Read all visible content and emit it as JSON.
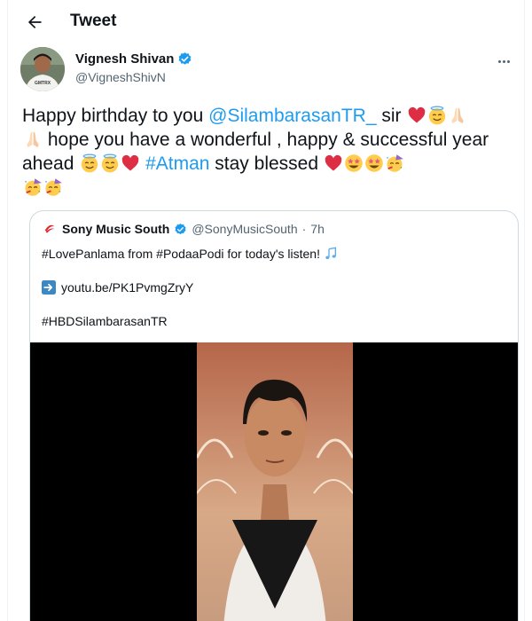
{
  "header": {
    "title": "Tweet",
    "back_icon": "arrow-left-icon"
  },
  "author": {
    "display_name": "Vignesh Shivan",
    "handle": "@VigneshShivN",
    "verified_icon": "verified-badge-icon",
    "more_icon": "more-horizontal-icon",
    "avatar_shirt_text": "GMTRX"
  },
  "tweet": {
    "t1": "Happy birthday to you ",
    "mention": "@SilambarasanTR_",
    "t2": " sir ",
    "t3": " hope you have a wonderful , happy & successful year ahead ",
    "hashtag": "#Atman",
    "t4": " stay blessed "
  },
  "quoted_tweet": {
    "display_name": "Sony Music South",
    "handle": "@SonyMusicSouth",
    "separator": "·",
    "time": "7h",
    "line1": "#LovePanlama from #PodaaPodi for today's listen! ",
    "link": "youtu.be/PK1PvmgZryY",
    "hashtag_line": "#HBDSilambarasanTR",
    "link_arrow_icon": "right-arrow-box-icon",
    "music_icon": "musical-notes-icon",
    "logo_icon": "sony-music-logo-icon",
    "media": "video-thumbnail"
  },
  "colors": {
    "link_blue": "#1d9bf0",
    "text_primary": "#0f1419",
    "text_secondary": "#536471",
    "border": "#cfd9de"
  }
}
